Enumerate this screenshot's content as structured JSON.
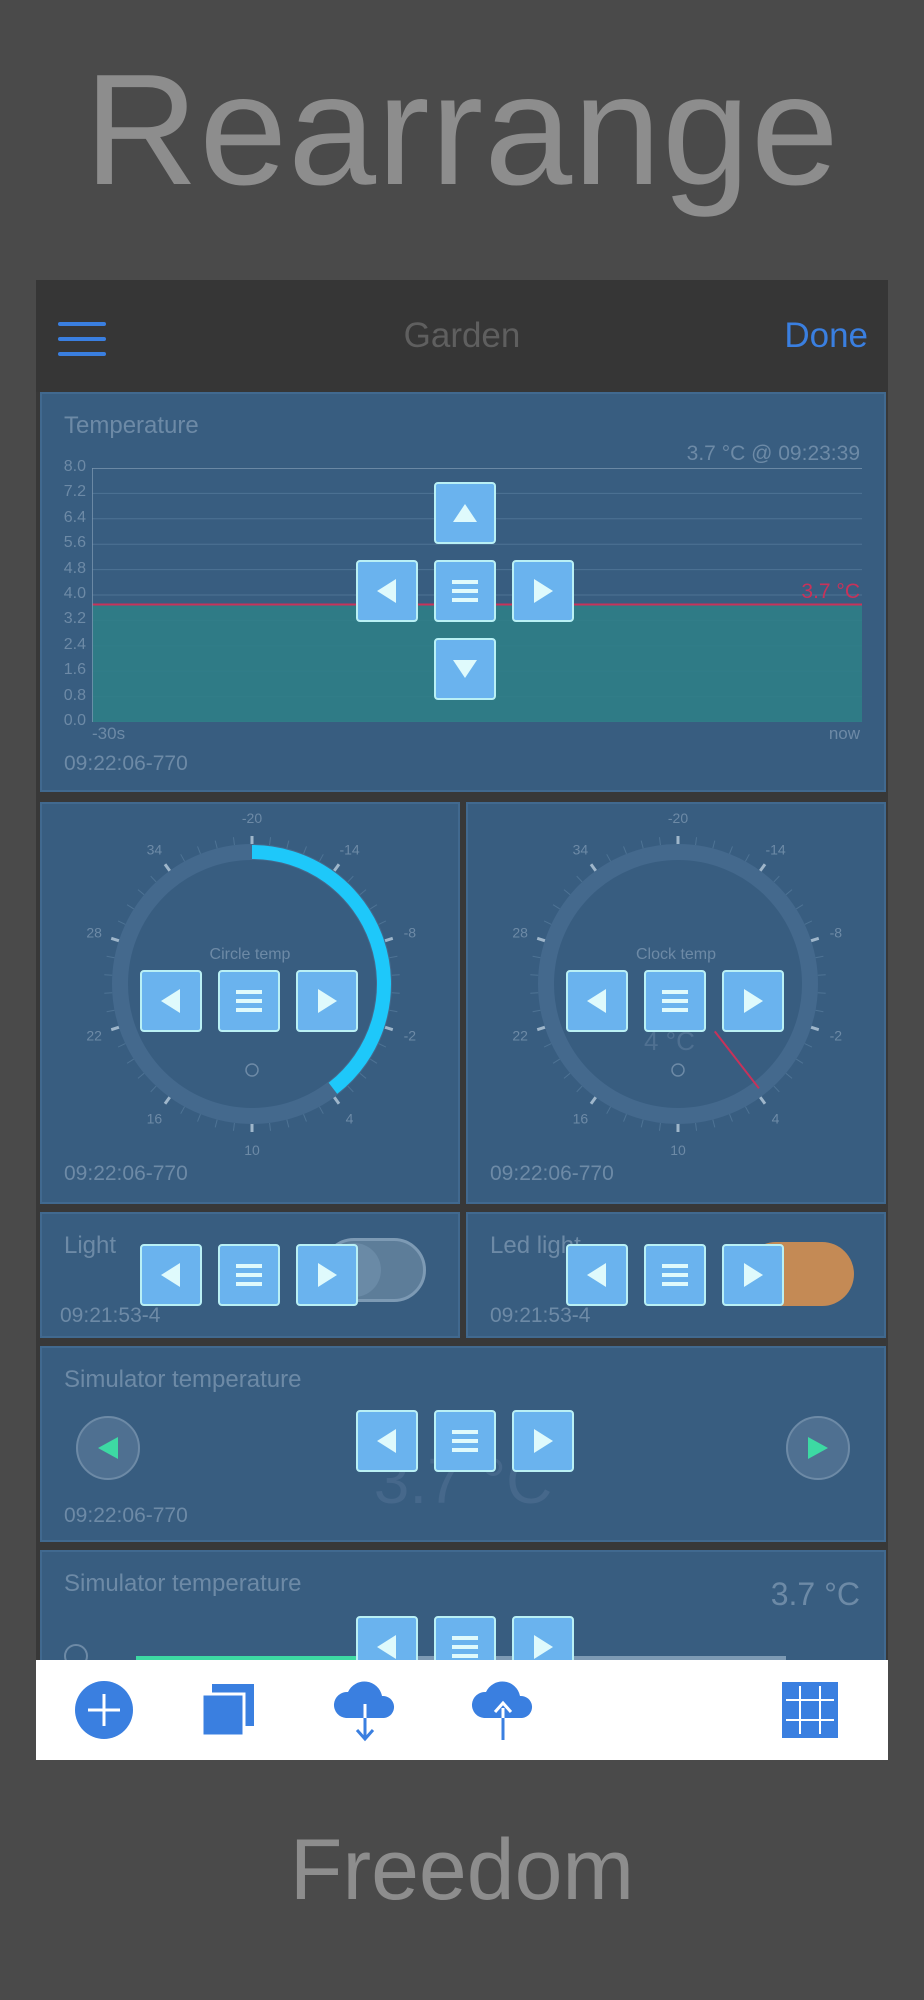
{
  "promo": {
    "headline": "Rearrange",
    "footer": "Freedom"
  },
  "navbar": {
    "title": "Garden",
    "done_label": "Done",
    "menu_icon": "hamburger-menu-icon"
  },
  "colors": {
    "accent": "#3a7fe0",
    "card": "#385d80",
    "gauge_blue": "#1ec8fa",
    "needle": "#c8325a",
    "led": "#c48a55",
    "chart_fill": "#2f7e86"
  },
  "temperature_card": {
    "title": "Temperature",
    "current": "3.7 °C @ 09:23:39",
    "marker": "3.7 °C",
    "x_start": "-30s",
    "x_end": "now",
    "timestamp": "09:22:06-770",
    "y_ticks": [
      "8.0",
      "7.2",
      "6.4",
      "5.6",
      "4.8",
      "4.0",
      "3.2",
      "2.4",
      "1.6",
      "0.8",
      "0.0"
    ]
  },
  "chart_data": {
    "type": "area",
    "x": [
      "-30s",
      "now"
    ],
    "y": [
      3.7,
      3.7
    ],
    "xlabel": "",
    "ylabel": "",
    "ylim": [
      0,
      8
    ],
    "grid": true
  },
  "circle_gauge": {
    "label": "Circle temp",
    "timestamp": "09:22:06-770",
    "ticks": [
      "-20",
      "-14",
      "-8",
      "-2",
      "4",
      "10",
      "16",
      "22",
      "28",
      "34"
    ],
    "value": 3.7
  },
  "clock_gauge": {
    "label": "Clock temp",
    "value_text": "4 °C",
    "timestamp": "09:22:06-770",
    "ticks": [
      "-20",
      "-14",
      "-8",
      "-2",
      "4",
      "10",
      "16",
      "22",
      "28",
      "34"
    ],
    "value": 3.7
  },
  "light_card": {
    "title": "Light",
    "timestamp": "09:21:53-4",
    "on": false
  },
  "led_card": {
    "title": "Led light",
    "timestamp": "09:21:53-4",
    "on": true
  },
  "sim_card": {
    "title": "Simulator temperature",
    "timestamp": "09:22:06-770",
    "value_text": "3.7 °C"
  },
  "sim_card2": {
    "title": "Simulator temperature",
    "value_text": "3.7 °C"
  },
  "toolbar": {
    "items": [
      "add-widget-icon",
      "duplicate-icon",
      "cloud-download-icon",
      "cloud-upload-icon",
      "grid-icon"
    ]
  }
}
